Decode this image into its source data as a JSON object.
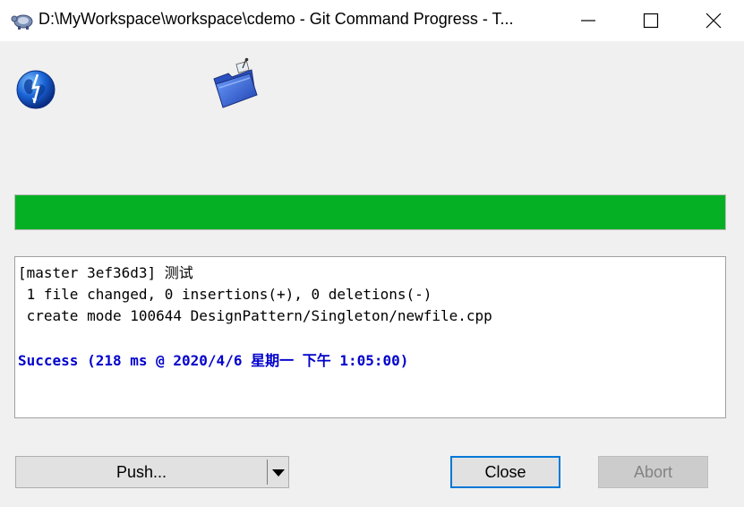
{
  "window": {
    "title": "D:\\MyWorkspace\\workspace\\cdemo - Git Command Progress - T...",
    "controls": {
      "minimize": "minimize-icon",
      "maximize": "maximize-icon",
      "close": "close-icon"
    }
  },
  "animation": {
    "left_icon": "globe-icon",
    "right_icon": "folder-icon"
  },
  "progress": {
    "fraction": 1.0,
    "color": "#06b025"
  },
  "log": {
    "lines": [
      "[master 3ef36d3] 测试",
      " 1 file changed, 0 insertions(+), 0 deletions(-)",
      " create mode 100644 DesignPattern/Singleton/newfile.cpp"
    ],
    "success": "Success (218 ms @ 2020/4/6 星期一 下午 1:05:00)",
    "success_color": "#0000cc"
  },
  "buttons": {
    "push_label": "Push...",
    "close_label": "Close",
    "abort_label": "Abort"
  }
}
